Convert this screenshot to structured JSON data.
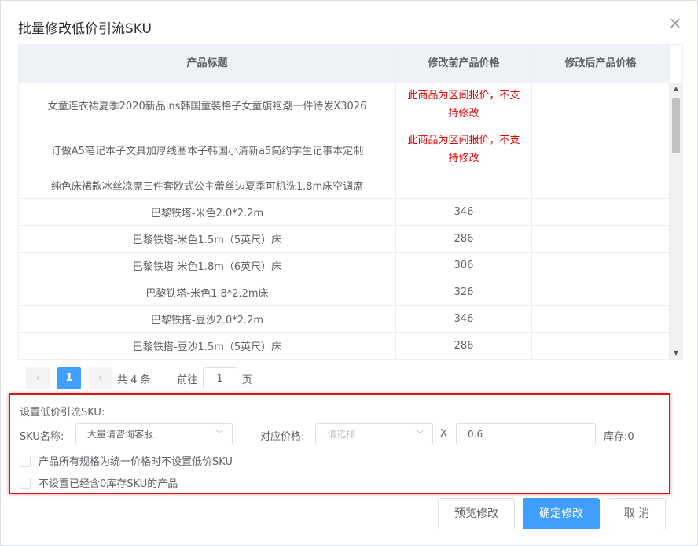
{
  "dialog": {
    "title": "批量修改低价引流SKU",
    "close_icon": "close-icon"
  },
  "table": {
    "headers": [
      "产品标题",
      "修改前产品价格",
      "修改后产品价格"
    ],
    "rows": [
      {
        "title": "女童连衣裙夏季2020新品ins韩国童装格子女童旗袍潮一件待发X3026",
        "price_before": "此商品为区间报价，不支持修改",
        "price_after": "",
        "warning": true
      },
      {
        "title": "订做A5笔记本子文具加厚线圈本子韩国小清新a5简约学生记事本定制",
        "price_before": "此商品为区间报价，不支持修改",
        "price_after": "",
        "warning": true
      },
      {
        "title": "纯色床裙款冰丝凉席三件套欧式公主蕾丝边夏季可机洗1.8m床空调席",
        "price_before": "",
        "price_after": "",
        "warning": false
      },
      {
        "title": "巴黎铁塔-米色2.0*2.2m",
        "price_before": "346",
        "price_after": "",
        "warning": false
      },
      {
        "title": "巴黎铁塔-米色1.5m（5英尺）床",
        "price_before": "286",
        "price_after": "",
        "warning": false
      },
      {
        "title": "巴黎铁塔-米色1.8m（6英尺）床",
        "price_before": "306",
        "price_after": "",
        "warning": false
      },
      {
        "title": "巴黎铁塔-米色1.8*2.2m床",
        "price_before": "326",
        "price_after": "",
        "warning": false
      },
      {
        "title": "巴黎铁搭-豆沙2.0*2.2m",
        "price_before": "346",
        "price_after": "",
        "warning": false
      },
      {
        "title": "巴黎铁搭-豆沙1.5m（5英尺）床",
        "price_before": "286",
        "price_after": "",
        "warning": false
      }
    ]
  },
  "pager": {
    "prev": "‹",
    "current_page": "1",
    "next": "›",
    "total": "共 4 条",
    "goto_label": "前往",
    "goto_value": "1",
    "page_suffix": "页"
  },
  "settings": {
    "section_label": "设置低价引流SKU:",
    "sku_label": "SKU名称:",
    "sku_value": "大量请咨询客服",
    "price_label": "对应价格:",
    "price_placeholder": "请选择",
    "times": "X",
    "multiplier": "0.6",
    "stock": "库存:0",
    "checkbox1": "产品所有规格为统一价格时不设置低价SKU",
    "checkbox2": "不设置已经含0库存SKU的产品"
  },
  "buttons": {
    "preview": "预览修改",
    "confirm": "确定修改",
    "cancel": "取 消"
  },
  "colors": {
    "primary": "#409eff",
    "warning_text": "#e00000",
    "highlight_border": "#d9151b"
  }
}
